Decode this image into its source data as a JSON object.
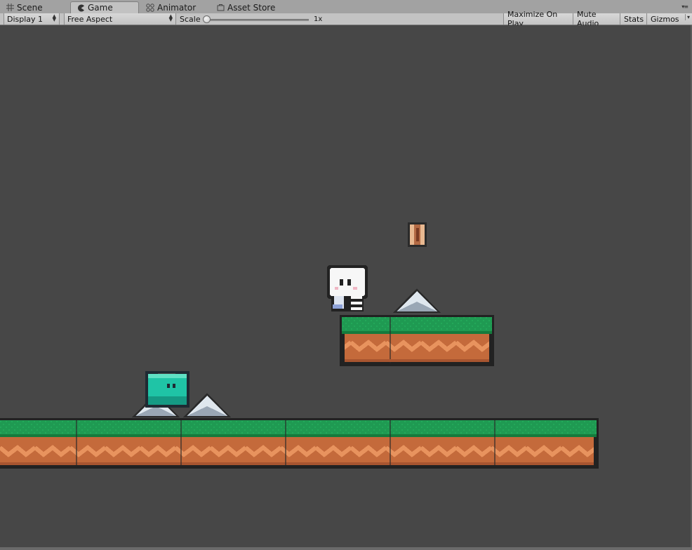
{
  "tabs": [
    {
      "label": "Scene",
      "icon": "grid-icon"
    },
    {
      "label": "Game",
      "icon": "pacman-icon",
      "active": true
    },
    {
      "label": "Animator",
      "icon": "animator-icon"
    },
    {
      "label": "Asset Store",
      "icon": "store-bag-icon"
    }
  ],
  "toolbar": {
    "display": "Display 1",
    "aspect": "Free Aspect",
    "scale_label": "Scale",
    "scale_value": "1x",
    "maximize_on_play": "Maximize On Play",
    "mute_audio": "Mute Audio",
    "stats": "Stats",
    "gizmos": "Gizmos"
  },
  "colors": {
    "editor_bg": "#474747",
    "toolbar_bg": "#c3c3c3",
    "grass": "#1f9a52",
    "dirt": "#c46a3b",
    "enemy": "#1fc4a6"
  }
}
